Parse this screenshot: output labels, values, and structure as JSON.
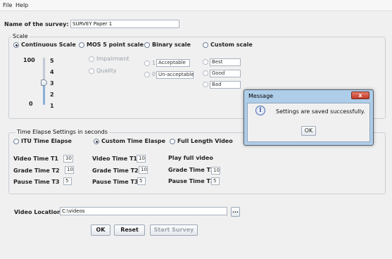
{
  "menu": {
    "file": "File",
    "help": "Help"
  },
  "survey": {
    "name_label": "Name of the survey:",
    "name_value": "SURVEY Paper 1"
  },
  "scale": {
    "title": "Scale",
    "options": {
      "continuous": "Continuous Scale",
      "mos5": "MOS 5 point scale",
      "binary": "Binary scale",
      "custom": "Custom scale"
    },
    "continuous": {
      "max": "100",
      "min": "0",
      "ticks": [
        "5",
        "4",
        "3",
        "2",
        "1"
      ]
    },
    "mos": {
      "impairment": "Impairment",
      "quality": "Quality"
    },
    "binary": {
      "one": "1",
      "zero": "0",
      "acceptable": "Acceptable",
      "unacceptable": "Un-acceptable"
    },
    "custom": {
      "values": [
        "Best",
        "Good",
        "Bad"
      ]
    }
  },
  "time": {
    "title": "Time Elapse Settings in seconds",
    "options": {
      "itu": "ITU Time Elapse",
      "custom": "Custom Time Elaspe",
      "full": "Full Length Video"
    },
    "itu": {
      "t1_label": "Video Time T1",
      "t1": "30",
      "t2_label": "Grade Time T2",
      "t2": "10",
      "t3_label": "Pause Time T3",
      "t3": "5"
    },
    "custom": {
      "t1_label": "Video Time T1",
      "t1": "10",
      "t2_label": "Grade Time T2",
      "t2": "10",
      "t3_label": "Pause Time T3",
      "t3": "5"
    },
    "full": {
      "play_label": "Play full video",
      "t2_label": "Grade Time T2",
      "t2": "10",
      "t3_label": "Pause Time T3",
      "t3": "5"
    }
  },
  "video": {
    "label": "Video Location:",
    "value": "C:\\videos",
    "browse": "..."
  },
  "buttons": {
    "ok": "OK",
    "reset": "Reset",
    "start": "Start Survey"
  },
  "dialog": {
    "title": "Message",
    "close": "x",
    "message": "Settings are saved successfully.",
    "ok": "OK",
    "info_glyph": "i"
  }
}
